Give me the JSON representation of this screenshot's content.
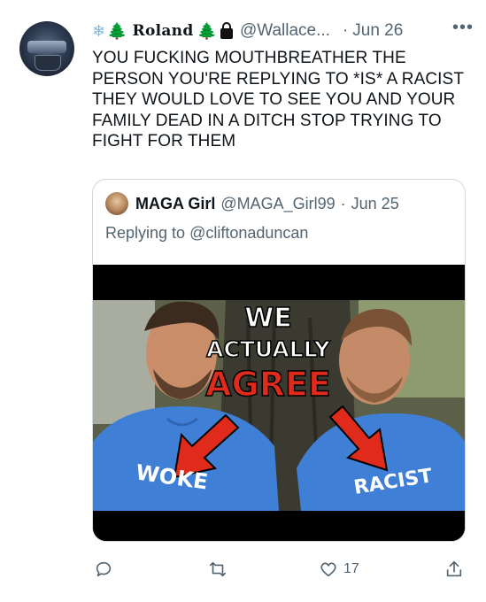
{
  "tweet": {
    "display_name": "Roland",
    "name_emojis_before": [
      "❄",
      "🌲"
    ],
    "name_emojis_after": [
      "🌲"
    ],
    "handle": "@Wallace...",
    "separator": "·",
    "date": "Jun 26",
    "more_label": "•••",
    "text": "YOU FUCKING MOUTHBREATHER THE PERSON YOU'RE REPLYING TO *IS* A RACIST THEY WOULD LOVE TO SEE YOU AND YOUR FAMILY DEAD IN A DITCH STOP TRYING TO FIGHT FOR THEM"
  },
  "quoted_tweet": {
    "display_name": "MAGA Girl",
    "handle": "@MAGA_Girl99",
    "separator": "·",
    "date": "Jun 25",
    "replying_prefix": "Replying to",
    "replying_to": "@cliftonaduncan",
    "media": {
      "headline_line1": "WE",
      "headline_line2": "ACTUALLY",
      "headline_line3": "AGREE",
      "left_shirt_text": "WOKE",
      "right_shirt_text": "RACIST",
      "colors": {
        "shirt": "#3f80d6",
        "arrow": "#e02b1c",
        "agree": "#e02b1c"
      }
    }
  },
  "actions": {
    "reply_icon": "reply-icon",
    "retweet_icon": "retweet-icon",
    "like_icon": "heart-icon",
    "like_count": "17",
    "share_icon": "share-icon"
  },
  "colors": {
    "text": "#0f1419",
    "secondary": "#536471",
    "border": "#cfd9de"
  }
}
